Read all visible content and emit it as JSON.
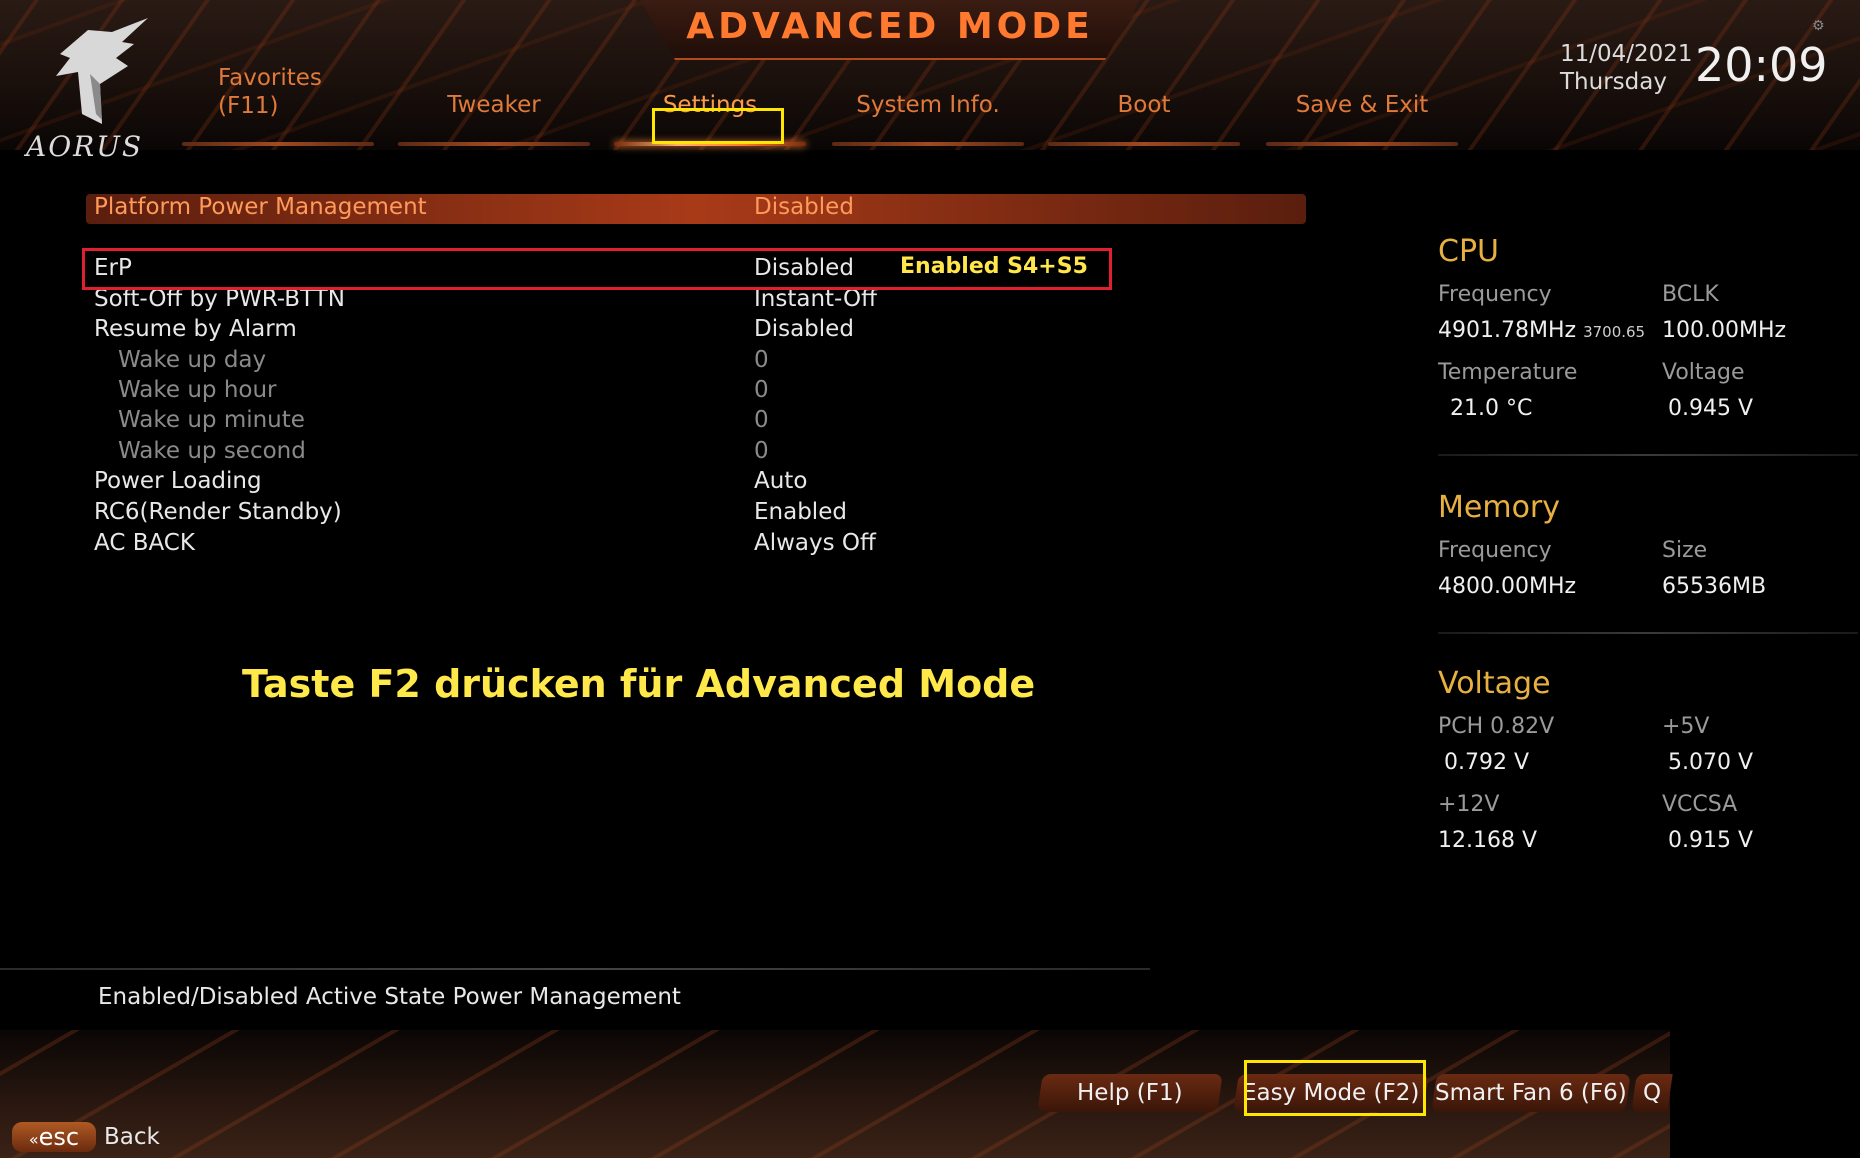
{
  "header": {
    "title": "ADVANCED MODE",
    "logo_text": "AORUS",
    "date": "11/04/2021",
    "weekday": "Thursday",
    "time": "20:09",
    "tabs": [
      {
        "label_line1": "Favorites",
        "label_line2": "(F11)"
      },
      {
        "label": "Tweaker"
      },
      {
        "label": "Settings"
      },
      {
        "label": "System Info."
      },
      {
        "label": "Boot"
      },
      {
        "label": "Save & Exit"
      }
    ]
  },
  "settings": {
    "rows": [
      {
        "name": "Platform Power Management",
        "value": "Disabled"
      },
      {
        "name": "ErP",
        "value": "Disabled"
      },
      {
        "name": "Soft-Off by PWR-BTTN",
        "value": "Instant-Off"
      },
      {
        "name": "Resume by Alarm",
        "value": "Disabled"
      },
      {
        "name": "Wake up day",
        "value": "0"
      },
      {
        "name": "Wake up hour",
        "value": "0"
      },
      {
        "name": "Wake up minute",
        "value": "0"
      },
      {
        "name": "Wake up second",
        "value": "0"
      },
      {
        "name": "Power Loading",
        "value": "Auto"
      },
      {
        "name": "RC6(Render Standby)",
        "value": "Enabled"
      },
      {
        "name": "AC BACK",
        "value": "Always Off"
      }
    ],
    "erp_note": "Enabled S4+S5"
  },
  "annotation": "Taste F2 drücken für Advanced Mode",
  "status": {
    "cpu": {
      "title": "CPU",
      "freq_label": "Frequency",
      "freq_value": "4901.78MHz",
      "freq_small": "3700.65",
      "bclk_label": "BCLK",
      "bclk_value": "100.00MHz",
      "temp_label": "Temperature",
      "temp_value": "21.0 °C",
      "volt_label": "Voltage",
      "volt_value": "0.945 V"
    },
    "memory": {
      "title": "Memory",
      "freq_label": "Frequency",
      "freq_value": "4800.00MHz",
      "size_label": "Size",
      "size_value": "65536MB"
    },
    "voltage": {
      "title": "Voltage",
      "pch_label": "PCH 0.82V",
      "pch_value": "0.792 V",
      "p5_label": "+5V",
      "p5_value": "5.070 V",
      "p12_label": "+12V",
      "p12_value": "12.168 V",
      "vccsa_label": "VCCSA",
      "vccsa_value": "0.915 V"
    }
  },
  "help_text": "Enabled/Disabled Active State Power Management",
  "footer": {
    "help": "Help (F1)",
    "easy": "Easy Mode (F2)",
    "fan": "Smart Fan 6 (F6)",
    "q": "Q",
    "esc": "esc",
    "back": "Back"
  },
  "colors": {
    "accent": "#ff7a2e",
    "highlight_red": "#e02030",
    "annotation_yellow": "#ffe84a",
    "section_title": "#e8b040"
  }
}
